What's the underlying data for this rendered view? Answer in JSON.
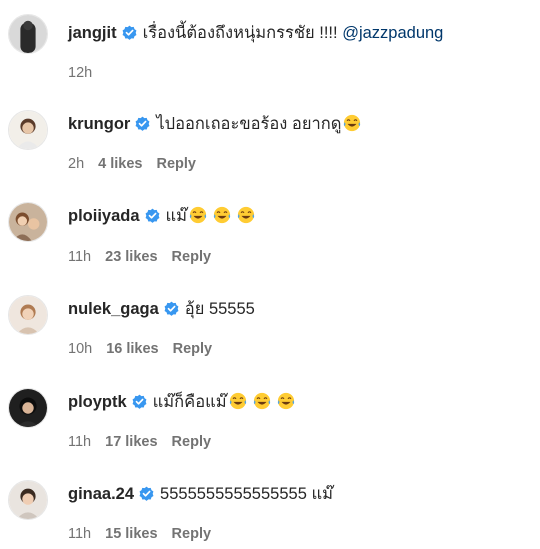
{
  "comments": [
    {
      "username": "jangjit",
      "text": "เรื่องนี้ต้องถึงหนุ่มกรรชัย !!!! ",
      "mention": "@jazzpadung",
      "emoji": [],
      "time": "12h",
      "likes": "",
      "reply": ""
    },
    {
      "username": "krungor",
      "text": "ไปออกเถอะขอร้อง อยากดู",
      "mention": "",
      "emoji": [
        "face-with-tears-of-joy-emoji"
      ],
      "time": "2h",
      "likes": "4 likes",
      "reply": "Reply"
    },
    {
      "username": "ploiiyada",
      "text": "แม๊",
      "emoji": [
        "face-with-tears-of-joy-emoji",
        "face-with-tears-of-joy-emoji",
        "face-with-tears-of-joy-emoji"
      ],
      "mention": "",
      "time": "11h",
      "likes": "23 likes",
      "reply": "Reply"
    },
    {
      "username": "nulek_gaga",
      "text": "อุ้ย 55555",
      "mention": "",
      "emoji": [],
      "time": "10h",
      "likes": "16 likes",
      "reply": "Reply"
    },
    {
      "username": "ploypt​k",
      "text": "แม๊ก็คือแม๊",
      "mention": "",
      "emoji": [
        "face-with-tears-of-joy-emoji",
        "face-with-tears-of-joy-emoji",
        "face-with-tears-of-joy-emoji"
      ],
      "time": "11h",
      "likes": "17 likes",
      "reply": "Reply"
    },
    {
      "username": "ginaa.24",
      "text": "5555555555555555 แม๊",
      "mention": "",
      "emoji": [],
      "time": "11h",
      "likes": "15 likes",
      "reply": "Reply"
    }
  ],
  "colors": {
    "verified": "#3897f0",
    "meta": "#737373",
    "mention": "#00376b",
    "text": "#262626"
  },
  "icons": {
    "verified": "verified-badge-icon",
    "emoji": "face-with-tears-of-joy-emoji"
  }
}
